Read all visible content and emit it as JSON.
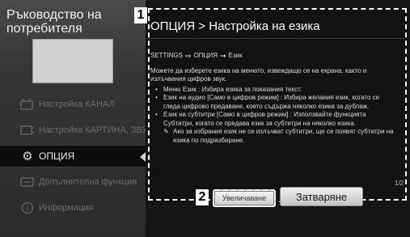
{
  "left_pane": {
    "title": "Ръководство на потребителя",
    "menu": [
      {
        "label": "Настройка КАНАЛ",
        "icon": "antenna-icon"
      },
      {
        "label": "Настройка КАРТИНА, ЗВУК",
        "icon": "picture-sound-icon"
      },
      {
        "label": "ОПЦИЯ",
        "icon": "gear-icon",
        "active": true
      },
      {
        "label": "Допълнителна функция",
        "icon": "extra-function-icon"
      },
      {
        "label": "Информация",
        "icon": "info-icon"
      }
    ]
  },
  "dialog": {
    "badge_1": "1",
    "title": "ОПЦИЯ > Настройка на езика",
    "path": {
      "settings": "SETTINGS",
      "option": "ОПЦИЯ",
      "language": "Език"
    },
    "description": "Можете да изберете езика на менюто, извеждащо се на екрана, както и излъчвания цифров звук.",
    "bullets": [
      "Меню Език : Избира езика за показания текст.",
      "Език на аудио [Само в цифров режим] : Избира желания език, когато се гледа цифрово предаване, което съдържа няколко езика за дублаж.",
      "Език на субтитри [Само в цифров режим] : Използвайте функцията Субтитри, когато се предава език за субтитри на няколко езика."
    ],
    "note": "Ако за избрания език не се излъчват субтитри, ще се появят субтитри на езика по подразбиране.",
    "page_indicator": "1/2"
  },
  "buttons": {
    "badge_2": "2",
    "zoom_label": "Увеличаване",
    "close_label": "Затваряне"
  },
  "colors": {
    "background": "#151515",
    "dialog_background": "#121212",
    "highlight_frame": "#ffffff",
    "button_face": "#d9d9d9"
  }
}
